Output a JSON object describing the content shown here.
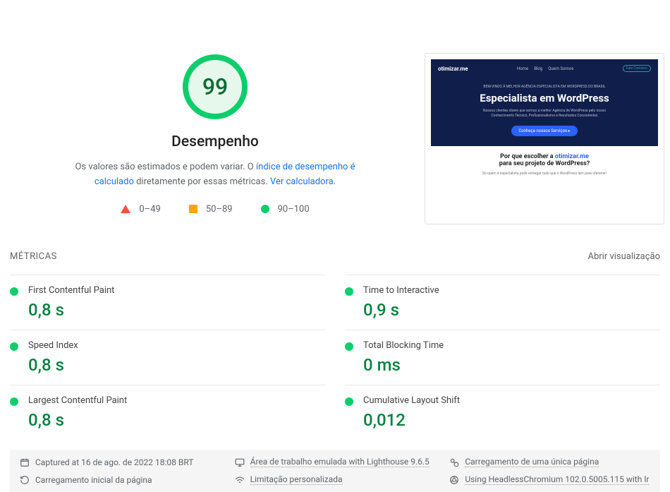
{
  "gauge": {
    "score": "99",
    "percent": 99
  },
  "category_title": "Desempenho",
  "disclaimer": {
    "prefix": "Os valores são estimados e podem variar. O ",
    "link1": "índice de desempenho é calculado",
    "middle": " diretamente por essas métricas. ",
    "link2": "Ver calculadora",
    "suffix": "."
  },
  "legend": {
    "fail": "0–49",
    "avg": "50–89",
    "pass": "90–100"
  },
  "screenshot": {
    "brand": "otimizar.me",
    "nav": [
      "Home",
      "Blog",
      "Quem Somos"
    ],
    "nav_btn": "Fale Conosco",
    "sub": "BEM-VINDO À MELHOR AGÊNCIA ESPECIALISTA EM WORDPRESS DO BRASIL",
    "h1": "Especialista em WordPress",
    "desc": "Nossos clientes dizem que somos a melhor Agência de WordPress pelo nosso Conhecimento Técnico, Profissionalismo e Resultados Consistentes",
    "cta": "Conheça nossos Serviços  ▸",
    "h2a": "Por que escolher a ",
    "h2brand": "otimizar.me",
    "h2b": "para seu projeto de WordPress?",
    "small": "Só quem é especialista pode entregar tudo que o WordPress tem para oferecer!"
  },
  "metrics_header": "MÉTRICAS",
  "expand_view": "Abrir visualização",
  "metrics": [
    {
      "name": "First Contentful Paint",
      "value": "0,8 s"
    },
    {
      "name": "Time to Interactive",
      "value": "0,9 s"
    },
    {
      "name": "Speed Index",
      "value": "0,8 s"
    },
    {
      "name": "Total Blocking Time",
      "value": "0 ms"
    },
    {
      "name": "Largest Contentful Paint",
      "value": "0,8 s"
    },
    {
      "name": "Cumulative Layout Shift",
      "value": "0,012"
    }
  ],
  "footer": {
    "captured": "Captured at 16 de ago. de 2022 18:08 BRT",
    "emulated": "Área de trabalho emulada with Lighthouse 9.6.5",
    "single_load": "Carregamento de uma única página",
    "initial_load": "Carregamento inicial da página",
    "throttling": "Limitação personalizada",
    "chromium": "Using HeadlessChromium 102.0.5005.115 with lr"
  }
}
